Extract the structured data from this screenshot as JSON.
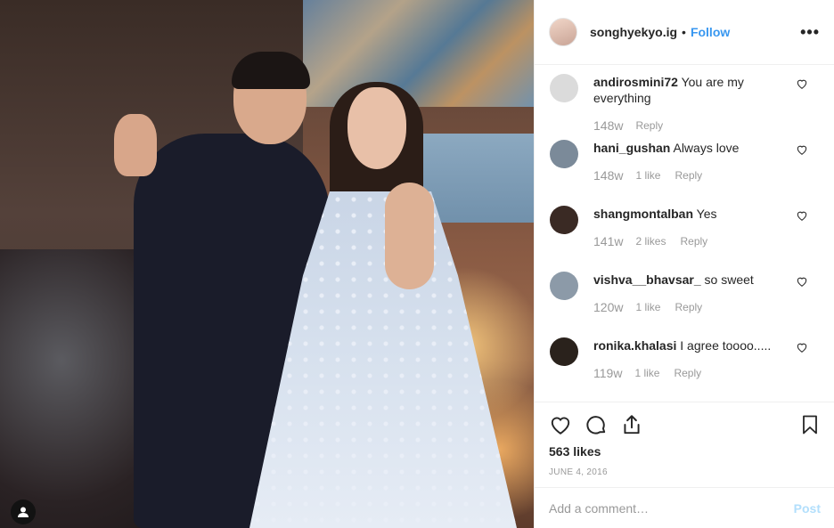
{
  "post": {
    "username": "songhyekyo.ig",
    "separator": "•",
    "follow_label": "Follow",
    "more_label": "•••"
  },
  "comments": [
    {
      "username": "andirosmini72",
      "text": "You are my everything",
      "time": "148w",
      "likes": "",
      "reply": "Reply",
      "avatar_color": "#dbdbdb"
    },
    {
      "username": "hani_gushan",
      "text": "Always love",
      "time": "148w",
      "likes": "1 like",
      "reply": "Reply",
      "avatar_color": "#7b8a99"
    },
    {
      "username": "shangmontalban",
      "text": "Yes",
      "time": "141w",
      "likes": "2 likes",
      "reply": "Reply",
      "avatar_color": "#3a2a24"
    },
    {
      "username": "vishva__bhavsar_",
      "text": "so sweet",
      "time": "120w",
      "likes": "1 like",
      "reply": "Reply",
      "avatar_color": "#8c9aa8"
    },
    {
      "username": "ronika.khalasi",
      "text": "I agree toooo.....",
      "time": "119w",
      "likes": "1 like",
      "reply": "Reply",
      "avatar_color": "#2a221c"
    }
  ],
  "actions": {
    "icons": [
      "heart-icon",
      "comment-icon",
      "share-icon",
      "bookmark-icon"
    ],
    "likes_label": "563 likes",
    "date_label": "JUNE 4, 2016"
  },
  "add_comment": {
    "placeholder": "Add a comment…",
    "post_label": "Post"
  },
  "colors": {
    "link": "#3897f0",
    "post_disabled": "#b2dffc",
    "muted": "#999999"
  }
}
